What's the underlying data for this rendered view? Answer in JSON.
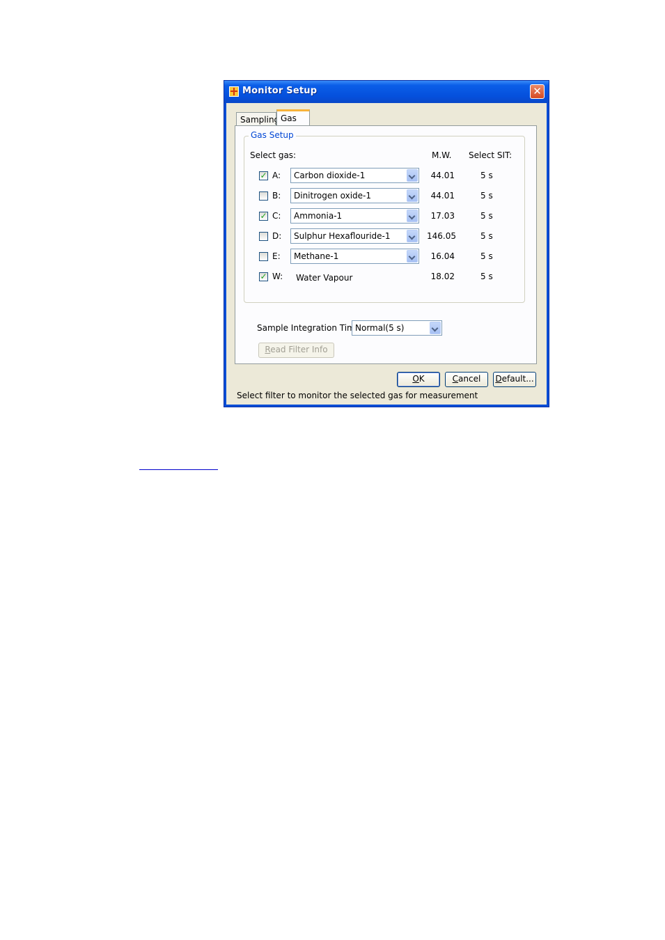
{
  "window": {
    "title": "Monitor Setup",
    "close_symbol": "✕"
  },
  "tabs": [
    {
      "label": "Sampling",
      "active": false
    },
    {
      "label": "Gas",
      "active": true
    }
  ],
  "gas_setup": {
    "group_title": "Gas Setup",
    "select_gas_label": "Select gas:",
    "mw_header": "M.W.",
    "sit_header": "Select SIT:",
    "rows": [
      {
        "letter": "A:",
        "checked": true,
        "gas": "Carbon dioxide-1",
        "mw": "44.01",
        "sit": "5 s",
        "has_dropdown": true
      },
      {
        "letter": "B:",
        "checked": false,
        "gas": "Dinitrogen oxide-1",
        "mw": "44.01",
        "sit": "5 s",
        "has_dropdown": true
      },
      {
        "letter": "C:",
        "checked": true,
        "gas": "Ammonia-1",
        "mw": "17.03",
        "sit": "5 s",
        "has_dropdown": true
      },
      {
        "letter": "D:",
        "checked": false,
        "gas": "Sulphur Hexaflouride-1",
        "mw": "146.05",
        "sit": "5 s",
        "has_dropdown": true
      },
      {
        "letter": "E:",
        "checked": false,
        "gas": "Methane-1",
        "mw": "16.04",
        "sit": "5 s",
        "has_dropdown": true
      },
      {
        "letter": "W:",
        "checked": true,
        "gas": "Water Vapour",
        "mw": "18.02",
        "sit": "5 s",
        "has_dropdown": false
      }
    ]
  },
  "integration": {
    "label": "Sample Integration Time:",
    "value": "Normal(5 s)"
  },
  "buttons": {
    "read_filter": {
      "accel": "R",
      "rest": "ead Filter Info"
    },
    "ok": {
      "accel": "O",
      "rest": "K"
    },
    "cancel": {
      "accel": "C",
      "rest": "ancel"
    },
    "default": {
      "accel": "D",
      "rest": "efault..."
    }
  },
  "status_text": "Select filter to monitor the selected gas for measurement",
  "colors": {
    "titlebar": "#0550dc",
    "group_title": "#0046d5",
    "check": "#21a121"
  }
}
